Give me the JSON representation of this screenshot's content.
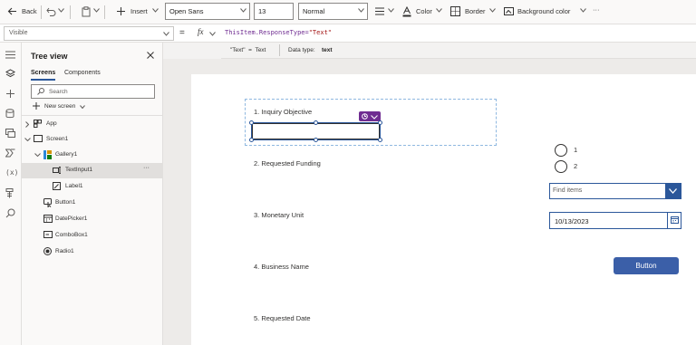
{
  "toolbar": {
    "back_label": "Back",
    "insert_label": "Insert",
    "font_value": "Open Sans",
    "size_value": "13",
    "weight_value": "Normal",
    "color_label": "Color",
    "border_label": "Border",
    "background_label": "Background color",
    "more_label": "···"
  },
  "formula": {
    "property": "Visible",
    "fx_label": "fx",
    "expr_prefix": "ThisItem.ResponseType=",
    "expr_string": "\"Text\"",
    "hint_result": "\"Text\"  =  Text",
    "hint_type_label": "Data type:",
    "hint_type_value": "text"
  },
  "tree": {
    "title": "Tree view",
    "tabs": [
      "Screens",
      "Components"
    ],
    "active_tab": "Screens",
    "search_placeholder": "Search",
    "new_screen_label": "New screen",
    "items": [
      {
        "label": "App",
        "icon": "app-icon"
      },
      {
        "label": "Screen1",
        "icon": "screen-icon"
      },
      {
        "label": "Gallery1",
        "icon": "gallery-icon"
      },
      {
        "label": "TextInput1",
        "icon": "textinput-icon",
        "selected": true
      },
      {
        "label": "Label1",
        "icon": "label-icon"
      },
      {
        "label": "Button1",
        "icon": "button-icon"
      },
      {
        "label": "DatePicker1",
        "icon": "datepicker-icon"
      },
      {
        "label": "ComboBox1",
        "icon": "combobox-icon"
      },
      {
        "label": "Radio1",
        "icon": "radio-icon"
      }
    ],
    "more_label": "···"
  },
  "canvas": {
    "questions": [
      "1. Inquiry Objective",
      "2. Requested Funding",
      "3. Monetary Unit",
      "4. Business Name",
      "5. Requested Date"
    ],
    "radio_options": [
      "1",
      "2"
    ],
    "combobox_placeholder": "Find items",
    "date_value": "10/13/2023",
    "button_label": "Button"
  },
  "colors": {
    "accent": "#2b579a",
    "button": "#3b5fa8",
    "selection": "#6f2c91",
    "canvas": "#ffffff"
  }
}
